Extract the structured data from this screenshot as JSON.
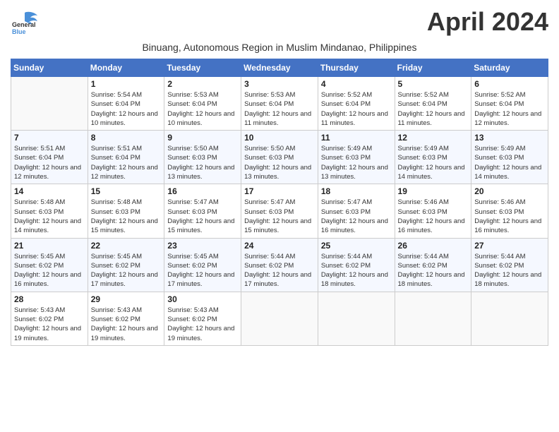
{
  "header": {
    "logo_general": "General",
    "logo_blue": "Blue",
    "month_title": "April 2024",
    "subtitle": "Binuang, Autonomous Region in Muslim Mindanao, Philippines"
  },
  "days_of_week": [
    "Sunday",
    "Monday",
    "Tuesday",
    "Wednesday",
    "Thursday",
    "Friday",
    "Saturday"
  ],
  "weeks": [
    {
      "days": [
        {
          "num": "",
          "sunrise": "",
          "sunset": "",
          "daylight": ""
        },
        {
          "num": "1",
          "sunrise": "Sunrise: 5:54 AM",
          "sunset": "Sunset: 6:04 PM",
          "daylight": "Daylight: 12 hours and 10 minutes."
        },
        {
          "num": "2",
          "sunrise": "Sunrise: 5:53 AM",
          "sunset": "Sunset: 6:04 PM",
          "daylight": "Daylight: 12 hours and 10 minutes."
        },
        {
          "num": "3",
          "sunrise": "Sunrise: 5:53 AM",
          "sunset": "Sunset: 6:04 PM",
          "daylight": "Daylight: 12 hours and 11 minutes."
        },
        {
          "num": "4",
          "sunrise": "Sunrise: 5:52 AM",
          "sunset": "Sunset: 6:04 PM",
          "daylight": "Daylight: 12 hours and 11 minutes."
        },
        {
          "num": "5",
          "sunrise": "Sunrise: 5:52 AM",
          "sunset": "Sunset: 6:04 PM",
          "daylight": "Daylight: 12 hours and 11 minutes."
        },
        {
          "num": "6",
          "sunrise": "Sunrise: 5:52 AM",
          "sunset": "Sunset: 6:04 PM",
          "daylight": "Daylight: 12 hours and 12 minutes."
        }
      ]
    },
    {
      "days": [
        {
          "num": "7",
          "sunrise": "Sunrise: 5:51 AM",
          "sunset": "Sunset: 6:04 PM",
          "daylight": "Daylight: 12 hours and 12 minutes."
        },
        {
          "num": "8",
          "sunrise": "Sunrise: 5:51 AM",
          "sunset": "Sunset: 6:04 PM",
          "daylight": "Daylight: 12 hours and 12 minutes."
        },
        {
          "num": "9",
          "sunrise": "Sunrise: 5:50 AM",
          "sunset": "Sunset: 6:03 PM",
          "daylight": "Daylight: 12 hours and 13 minutes."
        },
        {
          "num": "10",
          "sunrise": "Sunrise: 5:50 AM",
          "sunset": "Sunset: 6:03 PM",
          "daylight": "Daylight: 12 hours and 13 minutes."
        },
        {
          "num": "11",
          "sunrise": "Sunrise: 5:49 AM",
          "sunset": "Sunset: 6:03 PM",
          "daylight": "Daylight: 12 hours and 13 minutes."
        },
        {
          "num": "12",
          "sunrise": "Sunrise: 5:49 AM",
          "sunset": "Sunset: 6:03 PM",
          "daylight": "Daylight: 12 hours and 14 minutes."
        },
        {
          "num": "13",
          "sunrise": "Sunrise: 5:49 AM",
          "sunset": "Sunset: 6:03 PM",
          "daylight": "Daylight: 12 hours and 14 minutes."
        }
      ]
    },
    {
      "days": [
        {
          "num": "14",
          "sunrise": "Sunrise: 5:48 AM",
          "sunset": "Sunset: 6:03 PM",
          "daylight": "Daylight: 12 hours and 14 minutes."
        },
        {
          "num": "15",
          "sunrise": "Sunrise: 5:48 AM",
          "sunset": "Sunset: 6:03 PM",
          "daylight": "Daylight: 12 hours and 15 minutes."
        },
        {
          "num": "16",
          "sunrise": "Sunrise: 5:47 AM",
          "sunset": "Sunset: 6:03 PM",
          "daylight": "Daylight: 12 hours and 15 minutes."
        },
        {
          "num": "17",
          "sunrise": "Sunrise: 5:47 AM",
          "sunset": "Sunset: 6:03 PM",
          "daylight": "Daylight: 12 hours and 15 minutes."
        },
        {
          "num": "18",
          "sunrise": "Sunrise: 5:47 AM",
          "sunset": "Sunset: 6:03 PM",
          "daylight": "Daylight: 12 hours and 16 minutes."
        },
        {
          "num": "19",
          "sunrise": "Sunrise: 5:46 AM",
          "sunset": "Sunset: 6:03 PM",
          "daylight": "Daylight: 12 hours and 16 minutes."
        },
        {
          "num": "20",
          "sunrise": "Sunrise: 5:46 AM",
          "sunset": "Sunset: 6:03 PM",
          "daylight": "Daylight: 12 hours and 16 minutes."
        }
      ]
    },
    {
      "days": [
        {
          "num": "21",
          "sunrise": "Sunrise: 5:45 AM",
          "sunset": "Sunset: 6:02 PM",
          "daylight": "Daylight: 12 hours and 16 minutes."
        },
        {
          "num": "22",
          "sunrise": "Sunrise: 5:45 AM",
          "sunset": "Sunset: 6:02 PM",
          "daylight": "Daylight: 12 hours and 17 minutes."
        },
        {
          "num": "23",
          "sunrise": "Sunrise: 5:45 AM",
          "sunset": "Sunset: 6:02 PM",
          "daylight": "Daylight: 12 hours and 17 minutes."
        },
        {
          "num": "24",
          "sunrise": "Sunrise: 5:44 AM",
          "sunset": "Sunset: 6:02 PM",
          "daylight": "Daylight: 12 hours and 17 minutes."
        },
        {
          "num": "25",
          "sunrise": "Sunrise: 5:44 AM",
          "sunset": "Sunset: 6:02 PM",
          "daylight": "Daylight: 12 hours and 18 minutes."
        },
        {
          "num": "26",
          "sunrise": "Sunrise: 5:44 AM",
          "sunset": "Sunset: 6:02 PM",
          "daylight": "Daylight: 12 hours and 18 minutes."
        },
        {
          "num": "27",
          "sunrise": "Sunrise: 5:44 AM",
          "sunset": "Sunset: 6:02 PM",
          "daylight": "Daylight: 12 hours and 18 minutes."
        }
      ]
    },
    {
      "days": [
        {
          "num": "28",
          "sunrise": "Sunrise: 5:43 AM",
          "sunset": "Sunset: 6:02 PM",
          "daylight": "Daylight: 12 hours and 19 minutes."
        },
        {
          "num": "29",
          "sunrise": "Sunrise: 5:43 AM",
          "sunset": "Sunset: 6:02 PM",
          "daylight": "Daylight: 12 hours and 19 minutes."
        },
        {
          "num": "30",
          "sunrise": "Sunrise: 5:43 AM",
          "sunset": "Sunset: 6:02 PM",
          "daylight": "Daylight: 12 hours and 19 minutes."
        },
        {
          "num": "",
          "sunrise": "",
          "sunset": "",
          "daylight": ""
        },
        {
          "num": "",
          "sunrise": "",
          "sunset": "",
          "daylight": ""
        },
        {
          "num": "",
          "sunrise": "",
          "sunset": "",
          "daylight": ""
        },
        {
          "num": "",
          "sunrise": "",
          "sunset": "",
          "daylight": ""
        }
      ]
    }
  ]
}
